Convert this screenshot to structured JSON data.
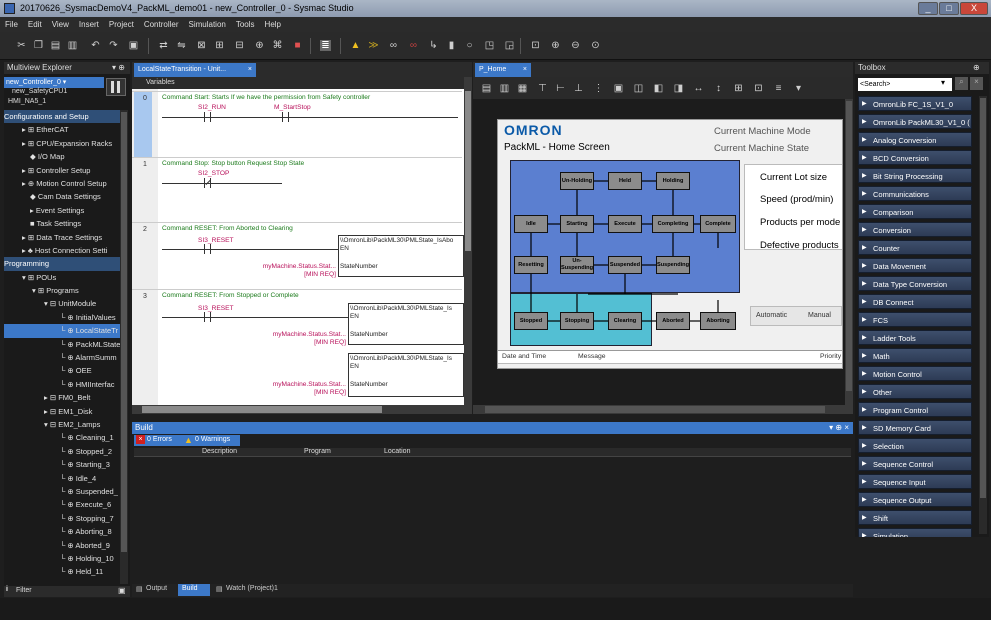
{
  "window": {
    "title": "20170626_SysmacDemoV4_PackML_demo01 - new_Controller_0 - Sysmac Studio",
    "min": "_",
    "max": "□",
    "close": "X"
  },
  "menu": [
    "File",
    "Edit",
    "View",
    "Insert",
    "Project",
    "Controller",
    "Simulation",
    "Tools",
    "Help"
  ],
  "explorer": {
    "title": "Multiview Explorer",
    "pin": "▾ ⊕",
    "dev": {
      "ctrl": "new_Controller_0 ▾",
      "safety": "new_SafetyCPU1",
      "hmi": "HMI_NA5_1"
    },
    "items": [
      {
        "text": "Configurations and Setup",
        "ind": 0,
        "k": "sec"
      },
      {
        "text": "▸ ⊞ EtherCAT",
        "ind": 18
      },
      {
        "text": "▸ ⊞ CPU/Expansion Racks",
        "ind": 18
      },
      {
        "text": "◆ I/O Map",
        "ind": 26
      },
      {
        "text": "▸ ⊞ Controller Setup",
        "ind": 18
      },
      {
        "text": "▸ ⊕ Motion Control Setup",
        "ind": 18
      },
      {
        "text": "◆ Cam Data Settings",
        "ind": 26
      },
      {
        "text": "▸ Event Settings",
        "ind": 26
      },
      {
        "text": "■ Task Settings",
        "ind": 26
      },
      {
        "text": "▸ ⊞ Data Trace Settings",
        "ind": 18
      },
      {
        "text": "▸ ♣ Host Connection Setti",
        "ind": 18
      },
      {
        "text": "Programming",
        "ind": 0,
        "k": "sec"
      },
      {
        "text": "▾ ⊞ POUs",
        "ind": 18
      },
      {
        "text": "▾ ⊞ Programs",
        "ind": 28
      },
      {
        "text": "▾ ⊟ UnitModule",
        "ind": 40
      },
      {
        "text": "└ ⊕ InitialValues",
        "ind": 56
      },
      {
        "text": "└ ⊕ LocalStateTr",
        "ind": 56,
        "k": "sel"
      },
      {
        "text": "└ ⊕ PackMLState",
        "ind": 56
      },
      {
        "text": "└ ⊕ AlarmSumm",
        "ind": 56
      },
      {
        "text": "└ ⊕ OEE",
        "ind": 56
      },
      {
        "text": "└ ⊕ HMIInterfac",
        "ind": 56
      },
      {
        "text": "▸ ⊟ FM0_Belt",
        "ind": 40
      },
      {
        "text": "▸ ⊟ EM1_Disk",
        "ind": 40
      },
      {
        "text": "▾ ⊟ EM2_Lamps",
        "ind": 40
      },
      {
        "text": "└ ⊕ Cleaning_1",
        "ind": 56
      },
      {
        "text": "└ ⊕ Stopped_2",
        "ind": 56
      },
      {
        "text": "└ ⊕ Starting_3",
        "ind": 56
      },
      {
        "text": "└ ⊕ Idle_4",
        "ind": 56
      },
      {
        "text": "└ ⊕ Suspended_",
        "ind": 56
      },
      {
        "text": "└ ⊕ Execute_6",
        "ind": 56
      },
      {
        "text": "└ ⊕ Stopping_7",
        "ind": 56
      },
      {
        "text": "└ ⊕ Aborting_8",
        "ind": 56
      },
      {
        "text": "└ ⊕ Aborted_9",
        "ind": 56
      },
      {
        "text": "└ ⊕ Holding_10",
        "ind": 56
      },
      {
        "text": "└ ⊕ Held_11",
        "ind": 56
      }
    ],
    "filter": "Filter"
  },
  "ladder": {
    "tab": "LocalStateTransition - Unit...",
    "close": "×",
    "vars": "Variables",
    "rungs": [
      {
        "num": "0",
        "comment": "Command Start: Starts If we have the permission from Safety controller",
        "c1": "SI2_RUN",
        "c2": "M_StartStop"
      },
      {
        "num": "1",
        "comment": "Command Stop: Stop button Request Stop State",
        "c1": "SI2_STOP"
      },
      {
        "num": "2",
        "comment": "Command RESET: From Aborted to Clearing",
        "c1": "SI3_RESET",
        "fb": "\\\\OmronLib\\PackML30\\PMLState_IsAbo",
        "en": "EN",
        "sn": "StateNumber",
        "in1": "myMachine.Status.Stat...",
        "in2": "[MIN REQ]"
      },
      {
        "num": "3",
        "comment": "Command RESET: From Stopped or Complete",
        "c1": "SI3_RESET",
        "fb": "\\\\OmronLib\\PackML30\\PMLState_Is",
        "en": "EN",
        "sn": "StateNumber",
        "in1": "myMachine.Status.Stat...",
        "in2": "[MIN REQ]",
        "fb2": "\\\\OmronLib\\PackML30\\PMLState_Is",
        "in3": "myMachine.Status.Stat...",
        "in4": "[MIN REQ]"
      }
    ]
  },
  "hmi": {
    "tab": "P_Home",
    "close": "×",
    "logo": "OMRON",
    "screen": "PackML - Home Screen",
    "mode": "Current Machine Mode",
    "state": "Current Machine State",
    "states": [
      "Un-Holding",
      "Held",
      "Holding",
      "Idle",
      "Starting",
      "Execute",
      "Completing",
      "Complete",
      "Resetting",
      "Un-Suspending",
      "Suspended",
      "Suspending",
      "Stopped",
      "Stopping",
      "Clearing",
      "Aborted",
      "Aborting"
    ],
    "info": [
      "Current Lot size",
      "Speed (prod/min)",
      "Products per mode",
      "Defective products"
    ],
    "auto": "Automatic",
    "manual": "Manual",
    "cols": [
      "Date and Time",
      "Message",
      "Priority"
    ],
    "blue": "#5b7fd0",
    "cyan": "#53bfd3"
  },
  "toolbox": {
    "title": "Toolbox",
    "search": "<Search>",
    "items": [
      "OmronLib FC_1S_V1_0 (1.0.0",
      "OmronLib PackML30_V1_0 (",
      "Analog Conversion",
      "BCD Conversion",
      "Bit String Processing",
      "Communications",
      "Comparison",
      "Conversion",
      "Counter",
      "Data Movement",
      "Data Type Conversion",
      "DB Connect",
      "FCS",
      "Ladder Tools",
      "Math",
      "Motion Control",
      "Other",
      "Program Control",
      "SD Memory Card",
      "Selection",
      "Sequence Control",
      "Sequence Input",
      "Sequence Output",
      "Shift",
      "Simulation"
    ]
  },
  "build": {
    "title": "Build",
    "pin": "▾ ⊕ ×",
    "errors": "0 Errors",
    "warnings": "0 Warnings",
    "cols": [
      "Description",
      "Program",
      "Location"
    ],
    "tabs": [
      "Output",
      "Build",
      "Watch (Project)1"
    ]
  }
}
